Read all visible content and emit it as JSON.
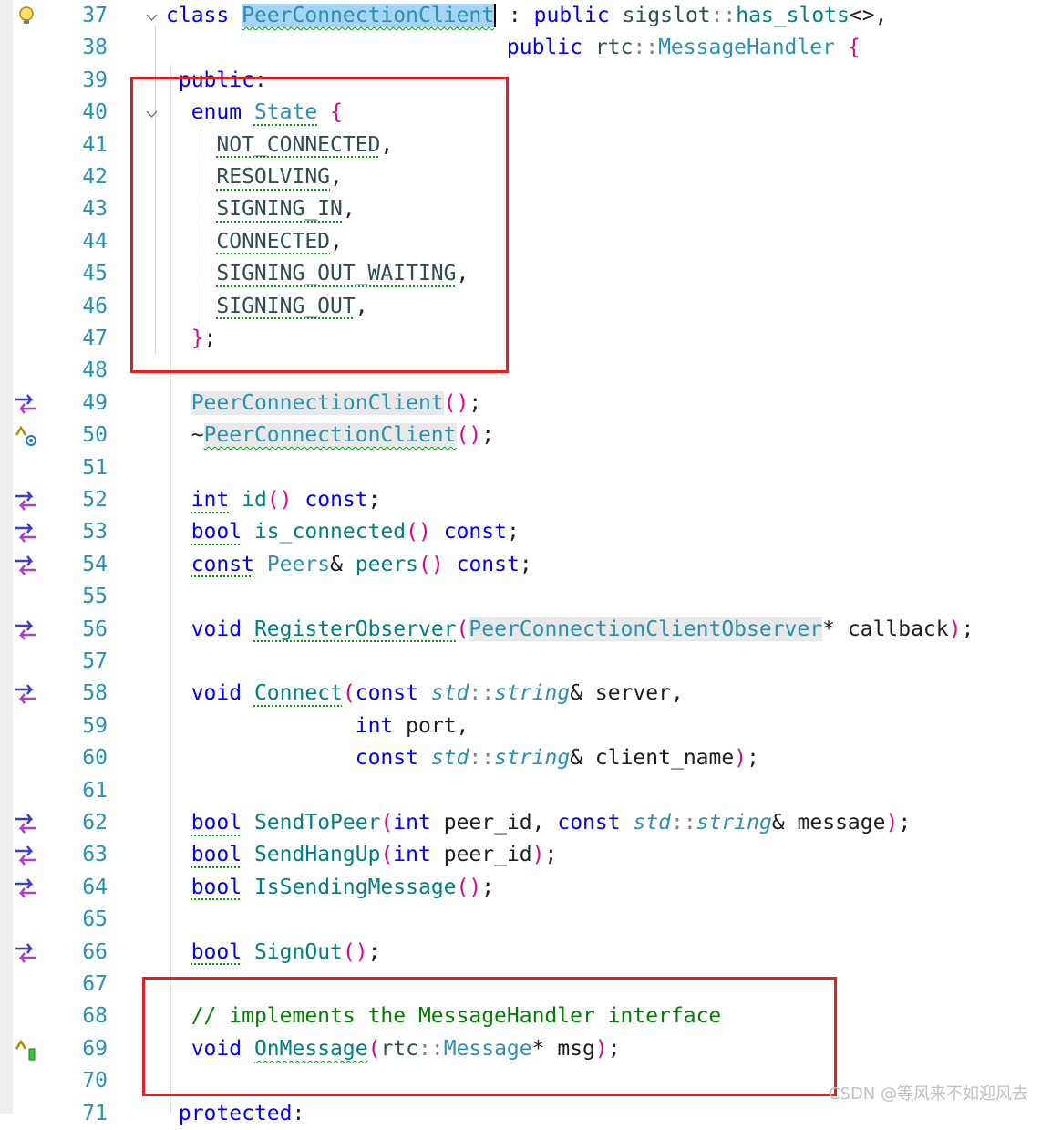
{
  "editor": {
    "lines": [
      {
        "num": "37",
        "text": "class PeerConnectionClient : public sigslot::has_slots<>,",
        "glyph": "lightbulb-icon",
        "fold": true
      },
      {
        "num": "38",
        "text": "                           public rtc::MessageHandler {",
        "glyph": null,
        "fold": false
      },
      {
        "num": "39",
        "text": " public:",
        "glyph": null,
        "fold": false
      },
      {
        "num": "40",
        "text": "  enum State {",
        "glyph": null,
        "fold": true
      },
      {
        "num": "41",
        "text": "    NOT_CONNECTED,",
        "glyph": null,
        "fold": false
      },
      {
        "num": "42",
        "text": "    RESOLVING,",
        "glyph": null,
        "fold": false
      },
      {
        "num": "43",
        "text": "    SIGNING_IN,",
        "glyph": null,
        "fold": false
      },
      {
        "num": "44",
        "text": "    CONNECTED,",
        "glyph": null,
        "fold": false
      },
      {
        "num": "45",
        "text": "    SIGNING_OUT_WAITING,",
        "glyph": null,
        "fold": false
      },
      {
        "num": "46",
        "text": "    SIGNING_OUT,",
        "glyph": null,
        "fold": false
      },
      {
        "num": "47",
        "text": "  };",
        "glyph": null,
        "fold": false
      },
      {
        "num": "48",
        "text": "",
        "glyph": null,
        "fold": false
      },
      {
        "num": "49",
        "text": "  PeerConnectionClient();",
        "glyph": "go-to-definition-icon",
        "fold": false
      },
      {
        "num": "50",
        "text": "  ~PeerConnectionClient();",
        "glyph": "override-marker-icon",
        "fold": false
      },
      {
        "num": "51",
        "text": "",
        "glyph": null,
        "fold": false
      },
      {
        "num": "52",
        "text": "  int id() const;",
        "glyph": "go-to-definition-icon",
        "fold": false
      },
      {
        "num": "53",
        "text": "  bool is_connected() const;",
        "glyph": "go-to-definition-icon",
        "fold": false
      },
      {
        "num": "54",
        "text": "  const Peers& peers() const;",
        "glyph": "go-to-definition-icon",
        "fold": false
      },
      {
        "num": "55",
        "text": "",
        "glyph": null,
        "fold": false
      },
      {
        "num": "56",
        "text": "  void RegisterObserver(PeerConnectionClientObserver* callback);",
        "glyph": "go-to-definition-icon",
        "fold": false
      },
      {
        "num": "57",
        "text": "",
        "glyph": null,
        "fold": false
      },
      {
        "num": "58",
        "text": "  void Connect(const std::string& server,",
        "glyph": "go-to-definition-icon",
        "fold": false
      },
      {
        "num": "59",
        "text": "               int port,",
        "glyph": null,
        "fold": false
      },
      {
        "num": "60",
        "text": "               const std::string& client_name);",
        "glyph": null,
        "fold": false
      },
      {
        "num": "61",
        "text": "",
        "glyph": null,
        "fold": false
      },
      {
        "num": "62",
        "text": "  bool SendToPeer(int peer_id, const std::string& message);",
        "glyph": "go-to-definition-icon",
        "fold": false
      },
      {
        "num": "63",
        "text": "  bool SendHangUp(int peer_id);",
        "glyph": "go-to-definition-icon",
        "fold": false
      },
      {
        "num": "64",
        "text": "  bool IsSendingMessage();",
        "glyph": "go-to-definition-icon",
        "fold": false
      },
      {
        "num": "65",
        "text": "",
        "glyph": null,
        "fold": false
      },
      {
        "num": "66",
        "text": "  bool SignOut();",
        "glyph": "go-to-definition-icon",
        "fold": false
      },
      {
        "num": "67",
        "text": "",
        "glyph": null,
        "fold": false
      },
      {
        "num": "68",
        "text": "  // implements the MessageHandler interface",
        "glyph": null,
        "fold": false
      },
      {
        "num": "69",
        "text": "  void OnMessage(rtc::Message* msg);",
        "glyph": "implements-marker-icon",
        "fold": false
      },
      {
        "num": "70",
        "text": "",
        "glyph": null,
        "fold": false
      },
      {
        "num": "71",
        "text": " protected:",
        "glyph": null,
        "fold": false
      }
    ]
  },
  "annotations": {
    "box_color": "#ee1c1c"
  },
  "watermark": "CSDN @等风来不如迎风去",
  "colors": {
    "keyword": "#0000ff",
    "type": "#2b91af",
    "function": "#008080",
    "comment": "#008000",
    "selection": "#a6d4f5"
  }
}
